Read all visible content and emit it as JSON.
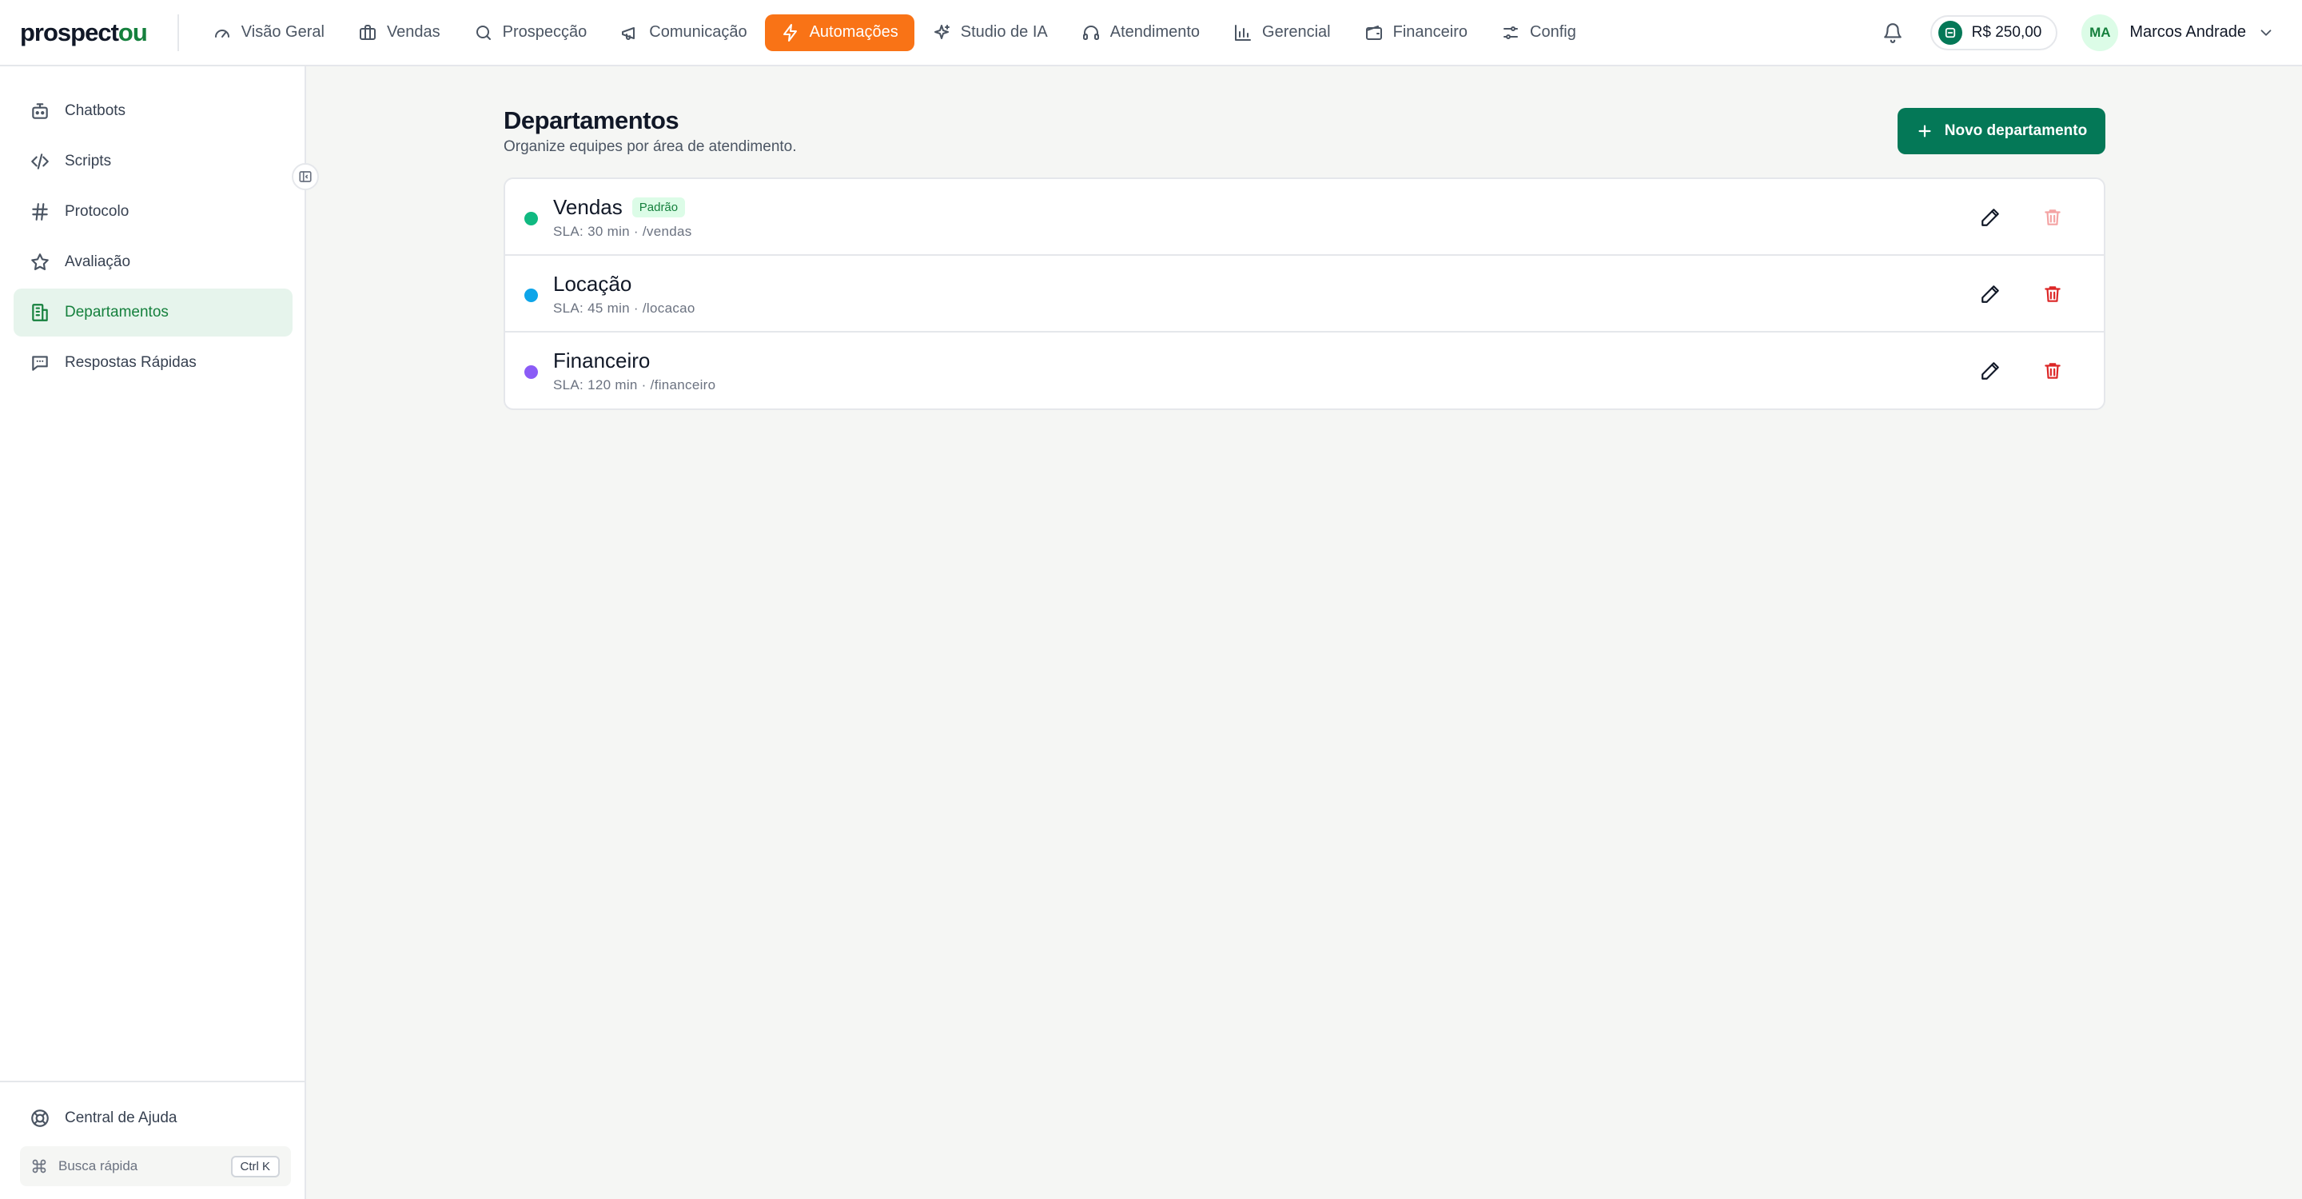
{
  "brand": {
    "logo_main": "prospect",
    "logo_accent": "ou",
    "accent_color": "#15803d"
  },
  "topnav": {
    "items": [
      {
        "label": "Visão Geral",
        "icon": "gauge-icon"
      },
      {
        "label": "Vendas",
        "icon": "briefcase-icon"
      },
      {
        "label": "Prospecção",
        "icon": "search-icon"
      },
      {
        "label": "Comunicação",
        "icon": "megaphone-icon"
      },
      {
        "label": "Automações",
        "icon": "lightning-icon",
        "active": true
      },
      {
        "label": "Studio de IA",
        "icon": "sparkles-icon"
      },
      {
        "label": "Atendimento",
        "icon": "headphones-icon"
      },
      {
        "label": "Gerencial",
        "icon": "bar-chart-icon"
      },
      {
        "label": "Financeiro",
        "icon": "wallet-icon"
      },
      {
        "label": "Config",
        "icon": "sliders-icon"
      }
    ],
    "active_color": "#f97316"
  },
  "header_right": {
    "balance": "R$ 250,00",
    "user_initials": "MA",
    "user_name": "Marcos Andrade"
  },
  "sidebar": {
    "items": [
      {
        "label": "Chatbots",
        "icon": "bot-icon"
      },
      {
        "label": "Scripts",
        "icon": "code-icon"
      },
      {
        "label": "Protocolo",
        "icon": "hash-icon"
      },
      {
        "label": "Avaliação",
        "icon": "star-icon"
      },
      {
        "label": "Departamentos",
        "icon": "building-icon",
        "active": true
      },
      {
        "label": "Respostas Rápidas",
        "icon": "message-icon"
      }
    ],
    "help_label": "Central de Ajuda",
    "quick_search_label": "Busca rápida",
    "quick_search_shortcut": "Ctrl K"
  },
  "main": {
    "title": "Departamentos",
    "subtitle": "Organize equipes por área de atendimento.",
    "new_button_label": "Novo departamento",
    "departments": [
      {
        "name": "Vendas",
        "badge": "Padrão",
        "meta": "SLA: 30 min · /vendas",
        "color": "#10b981",
        "delete_disabled": true
      },
      {
        "name": "Locação",
        "badge": "",
        "meta": "SLA: 45 min · /locacao",
        "color": "#0ea5e9",
        "delete_disabled": false
      },
      {
        "name": "Financeiro",
        "badge": "",
        "meta": "SLA: 120 min · /financeiro",
        "color": "#8b5cf6",
        "delete_disabled": false
      }
    ]
  }
}
